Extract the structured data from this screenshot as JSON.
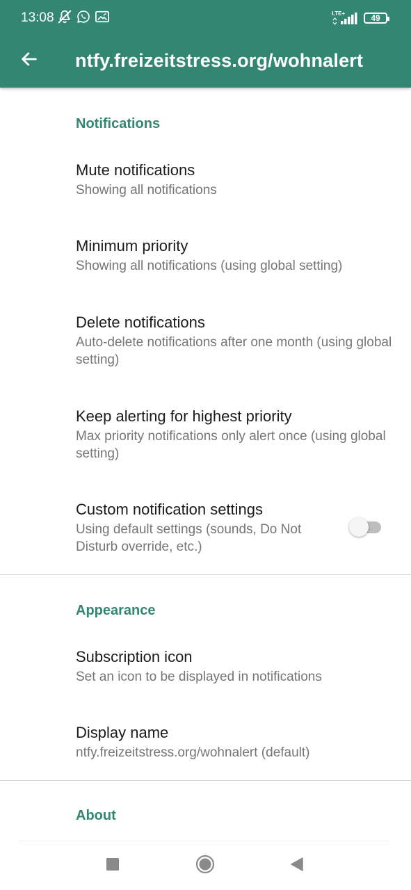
{
  "status_bar": {
    "time": "13:08",
    "network_label": "LTE+",
    "battery": "49",
    "icons": [
      "muted-bell-icon",
      "whatsapp-icon",
      "gallery-icon",
      "signal-icon",
      "battery-icon"
    ]
  },
  "app_bar": {
    "title": "ntfy.freizeitstress.org/wohnalert",
    "back_icon": "arrow-left-icon"
  },
  "sections": {
    "notifications": {
      "header": "Notifications",
      "items": [
        {
          "title": "Mute notifications",
          "summary": "Showing all notifications"
        },
        {
          "title": "Minimum priority",
          "summary": "Showing all notifications (using global setting)"
        },
        {
          "title": "Delete notifications",
          "summary": "Auto-delete notifications after one month (using global setting)"
        },
        {
          "title": "Keep alerting for highest priority",
          "summary": "Max priority notifications only alert once (using global setting)"
        },
        {
          "title": "Custom notification settings",
          "summary": "Using default settings (sounds, Do Not Disturb override, etc.)",
          "switch_on": false
        }
      ]
    },
    "appearance": {
      "header": "Appearance",
      "items": [
        {
          "title": "Subscription icon",
          "summary": "Set an icon to be displayed in notifications"
        },
        {
          "title": "Display name",
          "summary": "ntfy.freizeitstress.org/wohnalert (default)"
        }
      ]
    },
    "about": {
      "header": "About"
    }
  },
  "nav_bar": {
    "icons": [
      "recents-square-icon",
      "home-circle-icon",
      "back-triangle-icon"
    ]
  },
  "colors": {
    "accent": "#338772",
    "title_text": "#1b1b1b",
    "summary_text": "#757575",
    "switch_off_track": "#bdbdbd"
  }
}
